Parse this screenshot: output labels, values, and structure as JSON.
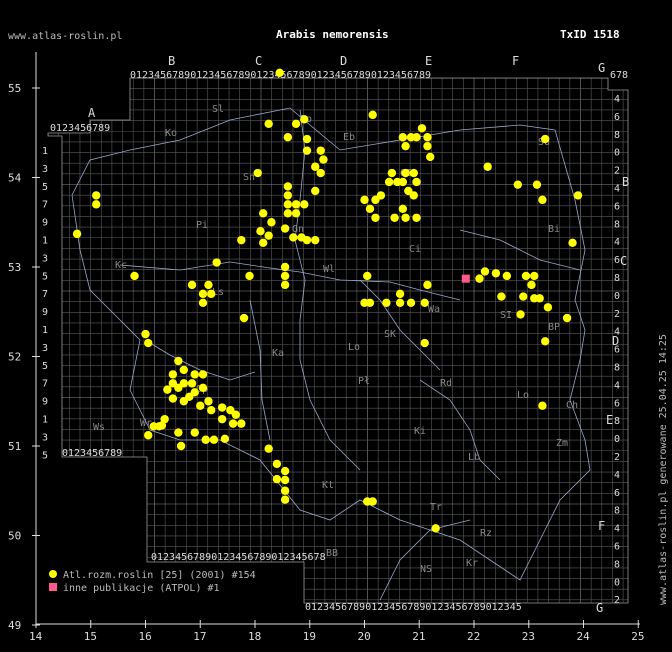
{
  "header": {
    "site": "www.atlas-roslin.pl",
    "species": "Arabis nemorensis",
    "taxon_id": "TxID 1518"
  },
  "side_note": "www.atlas-roslin.pl generowane 25.04.25 14:25",
  "axes": {
    "x_ticks": [
      "14",
      "15",
      "16",
      "17",
      "18",
      "19",
      "20",
      "21",
      "22",
      "23",
      "24",
      "25"
    ],
    "y_ticks": [
      "55",
      "54",
      "53",
      "52",
      "51",
      "50",
      "49"
    ]
  },
  "grid_labels": {
    "top_letters": [
      "A",
      "B",
      "C",
      "D",
      "E",
      "F",
      "G"
    ],
    "right_letters": [
      "B",
      "C",
      "D",
      "E",
      "F",
      "G"
    ],
    "digits_top": "0123456789",
    "digits_short": "012345678",
    "digits_tail": "012345",
    "right_digits": [
      "4",
      "6",
      "8",
      "0",
      "2",
      "4",
      "6",
      "8"
    ],
    "left_digits": [
      "1",
      "3",
      "5",
      "7",
      "9"
    ]
  },
  "regions": [
    {
      "t": "Sl"
    },
    {
      "t": "Po"
    },
    {
      "t": "Eb"
    },
    {
      "t": "Sn"
    },
    {
      "t": "OI"
    },
    {
      "t": "Su"
    },
    {
      "t": "Ko"
    },
    {
      "t": "Pi"
    },
    {
      "t": "Bi"
    },
    {
      "t": "Gn"
    },
    {
      "t": "Ci"
    },
    {
      "t": "Wl"
    },
    {
      "t": "Kc"
    },
    {
      "t": "Ls"
    },
    {
      "t": "Wa"
    },
    {
      "t": "SI"
    },
    {
      "t": "BP"
    },
    {
      "t": "Ka"
    },
    {
      "t": "Lo"
    },
    {
      "t": "SK"
    },
    {
      "t": "Pł"
    },
    {
      "t": "Rd"
    },
    {
      "t": "Lo"
    },
    {
      "t": "Ch"
    },
    {
      "t": "Wr"
    },
    {
      "t": "Op"
    },
    {
      "t": "Ki"
    },
    {
      "t": "Zm"
    },
    {
      "t": "Lb"
    },
    {
      "t": "Kt"
    },
    {
      "t": "BB"
    },
    {
      "t": "Tr"
    },
    {
      "t": "Rz"
    },
    {
      "t": "NS"
    },
    {
      "t": "Kr"
    },
    {
      "t": "Ws"
    }
  ],
  "map_data": {
    "lon_range": [
      14,
      25
    ],
    "lat_range": [
      49,
      55.5
    ],
    "series": [
      {
        "name": "Atl.rozm.roslin [25] (2001) #154",
        "color": "#ffff00",
        "points": [
          [
            18.45,
            55.17
          ],
          [
            18.25,
            54.6
          ],
          [
            18.75,
            54.6
          ],
          [
            18.9,
            54.65
          ],
          [
            18.6,
            54.45
          ],
          [
            18.95,
            54.43
          ],
          [
            18.95,
            54.3
          ],
          [
            19.2,
            54.3
          ],
          [
            19.25,
            54.2
          ],
          [
            19.1,
            54.12
          ],
          [
            19.2,
            54.05
          ],
          [
            18.05,
            54.05
          ],
          [
            20.15,
            54.7
          ],
          [
            20.7,
            54.45
          ],
          [
            20.85,
            54.45
          ],
          [
            20.95,
            54.45
          ],
          [
            21.05,
            54.55
          ],
          [
            21.15,
            54.45
          ],
          [
            20.75,
            54.35
          ],
          [
            21.15,
            54.35
          ],
          [
            21.2,
            54.23
          ],
          [
            20.5,
            54.05
          ],
          [
            20.7,
            53.95
          ],
          [
            20.75,
            54.05
          ],
          [
            20.9,
            54.05
          ],
          [
            20.45,
            53.95
          ],
          [
            20.6,
            53.95
          ],
          [
            20.8,
            53.85
          ],
          [
            20.95,
            53.95
          ],
          [
            20.9,
            53.8
          ],
          [
            20.3,
            53.8
          ],
          [
            20.0,
            53.75
          ],
          [
            20.2,
            53.75
          ],
          [
            20.1,
            53.65
          ],
          [
            20.2,
            53.55
          ],
          [
            20.55,
            53.55
          ],
          [
            20.75,
            53.55
          ],
          [
            20.7,
            53.65
          ],
          [
            20.95,
            53.55
          ],
          [
            18.6,
            53.9
          ],
          [
            18.6,
            53.8
          ],
          [
            18.6,
            53.7
          ],
          [
            18.75,
            53.7
          ],
          [
            18.9,
            53.7
          ],
          [
            19.1,
            53.85
          ],
          [
            18.6,
            53.6
          ],
          [
            18.75,
            53.6
          ],
          [
            18.15,
            53.6
          ],
          [
            18.3,
            53.5
          ],
          [
            18.1,
            53.4
          ],
          [
            18.55,
            53.43
          ],
          [
            18.25,
            53.35
          ],
          [
            18.85,
            53.33
          ],
          [
            18.95,
            53.3
          ],
          [
            19.1,
            53.3
          ],
          [
            18.7,
            53.33
          ],
          [
            18.15,
            53.27
          ],
          [
            17.75,
            53.3
          ],
          [
            17.3,
            53.05
          ],
          [
            17.9,
            52.9
          ],
          [
            18.55,
            53.0
          ],
          [
            18.55,
            52.9
          ],
          [
            18.55,
            52.8
          ],
          [
            20.05,
            52.9
          ],
          [
            20.0,
            52.6
          ],
          [
            20.1,
            52.6
          ],
          [
            20.4,
            52.6
          ],
          [
            20.65,
            52.6
          ],
          [
            20.65,
            52.7
          ],
          [
            20.85,
            52.6
          ],
          [
            21.1,
            52.6
          ],
          [
            21.15,
            52.8
          ],
          [
            21.1,
            52.15
          ],
          [
            17.05,
            52.7
          ],
          [
            17.15,
            52.8
          ],
          [
            17.2,
            52.7
          ],
          [
            16.85,
            52.8
          ],
          [
            17.05,
            52.6
          ],
          [
            17.8,
            52.43
          ],
          [
            16.0,
            52.25
          ],
          [
            16.05,
            52.15
          ],
          [
            16.6,
            51.95
          ],
          [
            16.5,
            51.8
          ],
          [
            16.7,
            51.85
          ],
          [
            16.9,
            51.8
          ],
          [
            17.05,
            51.8
          ],
          [
            16.4,
            51.63
          ],
          [
            16.5,
            51.7
          ],
          [
            16.6,
            51.65
          ],
          [
            16.7,
            51.7
          ],
          [
            16.85,
            51.7
          ],
          [
            16.9,
            51.6
          ],
          [
            17.05,
            51.65
          ],
          [
            16.5,
            51.53
          ],
          [
            16.7,
            51.5
          ],
          [
            16.8,
            51.55
          ],
          [
            17.0,
            51.45
          ],
          [
            17.15,
            51.5
          ],
          [
            17.2,
            51.4
          ],
          [
            17.4,
            51.43
          ],
          [
            17.55,
            51.4
          ],
          [
            17.65,
            51.35
          ],
          [
            17.4,
            51.3
          ],
          [
            17.6,
            51.25
          ],
          [
            17.75,
            51.25
          ],
          [
            16.35,
            51.3
          ],
          [
            16.3,
            51.23
          ],
          [
            16.25,
            51.22
          ],
          [
            16.15,
            51.22
          ],
          [
            16.05,
            51.12
          ],
          [
            16.6,
            51.15
          ],
          [
            16.9,
            51.15
          ],
          [
            17.1,
            51.07
          ],
          [
            17.25,
            51.07
          ],
          [
            17.45,
            51.08
          ],
          [
            16.65,
            51.0
          ],
          [
            18.25,
            50.97
          ],
          [
            18.4,
            50.8
          ],
          [
            18.55,
            50.72
          ],
          [
            18.55,
            50.62
          ],
          [
            18.4,
            50.63
          ],
          [
            18.55,
            50.5
          ],
          [
            18.55,
            50.4
          ],
          [
            20.05,
            50.38
          ],
          [
            20.15,
            50.38
          ],
          [
            21.3,
            50.08
          ],
          [
            22.25,
            54.12
          ],
          [
            22.8,
            53.92
          ],
          [
            23.15,
            53.92
          ],
          [
            23.25,
            53.75
          ],
          [
            23.3,
            54.43
          ],
          [
            23.9,
            53.8
          ],
          [
            23.8,
            53.27
          ],
          [
            22.2,
            52.95
          ],
          [
            22.4,
            52.93
          ],
          [
            22.6,
            52.9
          ],
          [
            22.95,
            52.9
          ],
          [
            23.1,
            52.9
          ],
          [
            22.1,
            52.87
          ],
          [
            22.5,
            52.67
          ],
          [
            23.05,
            52.8
          ],
          [
            22.9,
            52.67
          ],
          [
            23.1,
            52.65
          ],
          [
            23.2,
            52.65
          ],
          [
            23.35,
            52.55
          ],
          [
            22.85,
            52.47
          ],
          [
            23.7,
            52.43
          ],
          [
            23.3,
            52.17
          ],
          [
            23.25,
            51.45
          ],
          [
            15.8,
            52.9
          ],
          [
            15.1,
            53.8
          ],
          [
            15.1,
            53.7
          ],
          [
            14.75,
            53.37
          ]
        ]
      },
      {
        "name": "inne publikacje (ATPOL) #1",
        "color": "#ff5a8c",
        "points": [
          [
            21.85,
            52.87
          ]
        ]
      }
    ]
  }
}
